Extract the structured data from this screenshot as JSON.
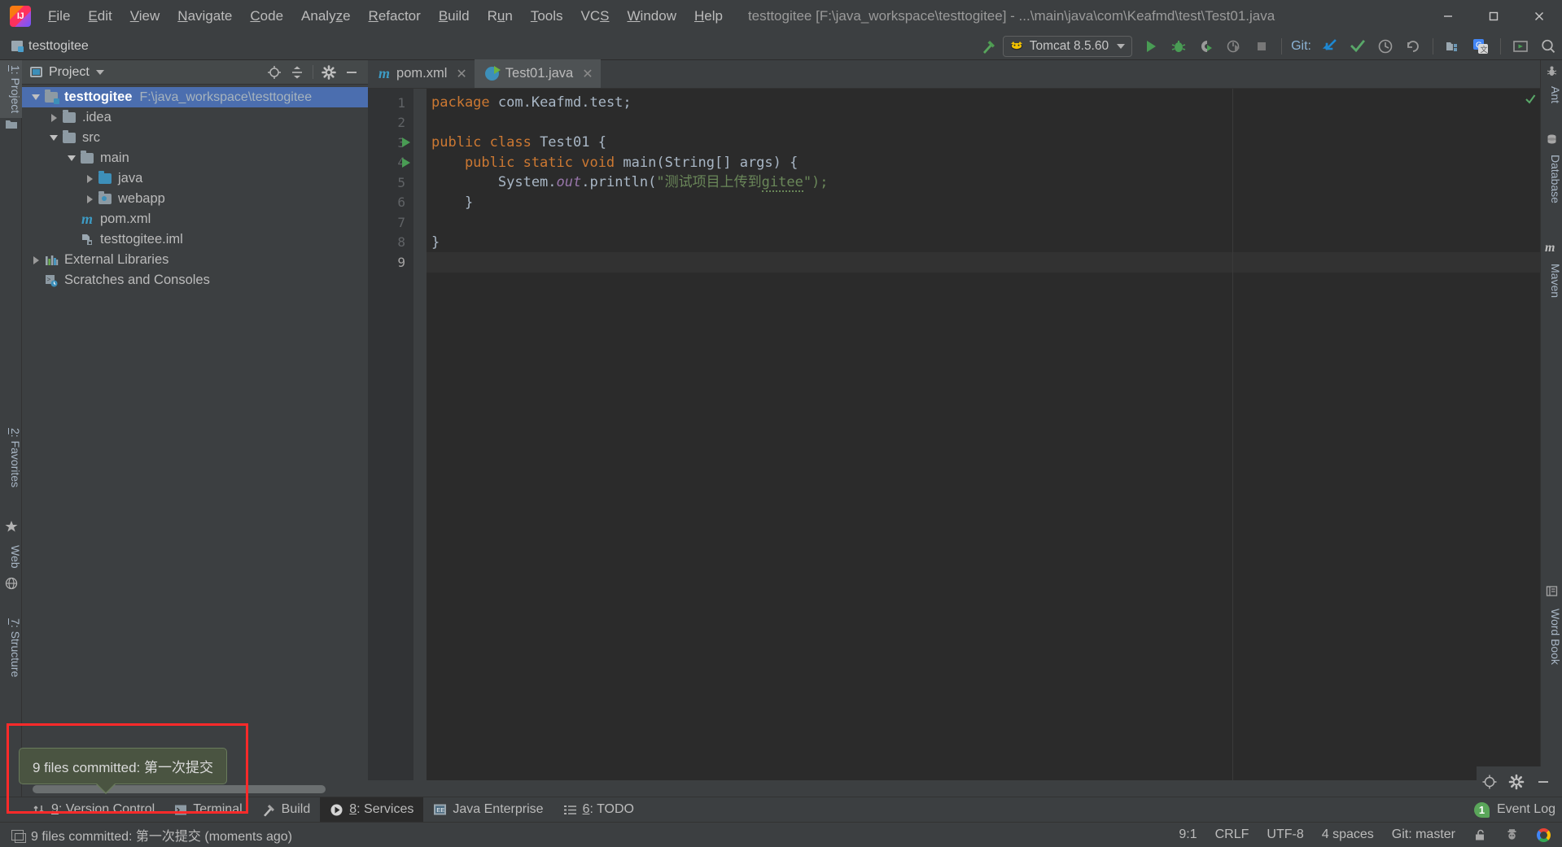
{
  "window": {
    "title": "testtogitee [F:\\java_workspace\\testtogitee] - ...\\main\\java\\com\\Keafmd\\test\\Test01.java",
    "minimize": "—",
    "maximize": "☐",
    "close": "✕"
  },
  "menu": {
    "items": [
      {
        "pre": "",
        "mn": "F",
        "post": "ile"
      },
      {
        "pre": "",
        "mn": "E",
        "post": "dit"
      },
      {
        "pre": "",
        "mn": "V",
        "post": "iew"
      },
      {
        "pre": "",
        "mn": "N",
        "post": "avigate"
      },
      {
        "pre": "",
        "mn": "C",
        "post": "ode"
      },
      {
        "pre": "Analy",
        "mn": "z",
        "post": "e"
      },
      {
        "pre": "",
        "mn": "R",
        "post": "efactor"
      },
      {
        "pre": "",
        "mn": "B",
        "post": "uild"
      },
      {
        "pre": "R",
        "mn": "u",
        "post": "n"
      },
      {
        "pre": "",
        "mn": "T",
        "post": "ools"
      },
      {
        "pre": "VC",
        "mn": "S",
        "post": ""
      },
      {
        "pre": "",
        "mn": "W",
        "post": "indow"
      },
      {
        "pre": "",
        "mn": "H",
        "post": "elp"
      }
    ]
  },
  "toolbar": {
    "project_chip": "testtogitee",
    "run_config": "Tomcat 8.5.60",
    "git_label": "Git:",
    "icons": {
      "build_hammer": "build-hammer-icon",
      "run": "run-icon",
      "debug": "debug-icon",
      "run_coverage": "run-with-coverage-icon",
      "profile": "profiler-icon",
      "stop": "stop-icon",
      "update_project": "git-update-project-icon",
      "commit": "git-commit-icon",
      "history": "git-history-icon",
      "rollback": "git-rollback-icon",
      "project_structure": "project-structure-icon",
      "translate": "translate-icon",
      "run_anything": "run-anything-icon",
      "search_everywhere": "search-everywhere-icon"
    }
  },
  "left_strip": {
    "tabs": [
      {
        "num": "1",
        "label": ": Project",
        "selected": true
      },
      {
        "num": "2",
        "label": ": Favorites",
        "selected": false
      },
      {
        "num": "",
        "label": "Web",
        "selected": false
      },
      {
        "num": "7",
        "label": ": Structure",
        "selected": false
      }
    ]
  },
  "right_strip": {
    "tabs": [
      {
        "label": "Ant"
      },
      {
        "label": "Database"
      },
      {
        "label": "Maven"
      },
      {
        "label": "Word Book"
      }
    ]
  },
  "project_panel": {
    "title": "Project",
    "actions": [
      "locate-icon",
      "collapse-all-icon",
      "settings-gear-icon",
      "hide-icon"
    ],
    "tree": [
      {
        "indent": 0,
        "toggle": "down",
        "icon": "module-folder",
        "label": "testtogitee",
        "bold": true,
        "path": "F:\\java_workspace\\testtogitee",
        "selected": true
      },
      {
        "indent": 1,
        "toggle": "right",
        "icon": "folder",
        "label": ".idea",
        "bold": false,
        "path": "",
        "selected": false
      },
      {
        "indent": 1,
        "toggle": "down",
        "icon": "folder",
        "label": "src",
        "bold": false,
        "path": "",
        "selected": false
      },
      {
        "indent": 2,
        "toggle": "down",
        "icon": "folder",
        "label": "main",
        "bold": false,
        "path": "",
        "selected": false
      },
      {
        "indent": 3,
        "toggle": "right",
        "icon": "source-folder",
        "label": "java",
        "bold": false,
        "path": "",
        "selected": false
      },
      {
        "indent": 3,
        "toggle": "right",
        "icon": "web-folder",
        "label": "webapp",
        "bold": false,
        "path": "",
        "selected": false
      },
      {
        "indent": 2,
        "toggle": "none",
        "icon": "maven-file",
        "label": "pom.xml",
        "bold": false,
        "path": "",
        "selected": false
      },
      {
        "indent": 2,
        "toggle": "none",
        "icon": "iml-file",
        "label": "testtogitee.iml",
        "bold": false,
        "path": "",
        "selected": false
      },
      {
        "indent": 0,
        "toggle": "right",
        "icon": "libraries",
        "label": "External Libraries",
        "bold": false,
        "path": "",
        "selected": false
      },
      {
        "indent": 0,
        "toggle": "none",
        "icon": "scratches",
        "label": "Scratches and Consoles",
        "bold": false,
        "path": "",
        "selected": false
      }
    ]
  },
  "editor": {
    "tabs": [
      {
        "label": "pom.xml",
        "icon": "maven-file-icon",
        "active": false,
        "close": "✕"
      },
      {
        "label": "Test01.java",
        "icon": "java-class-icon",
        "active": true,
        "close": "✕"
      }
    ],
    "lines": [
      {
        "n": "1",
        "runmark": false,
        "fold": "",
        "current": false
      },
      {
        "n": "2",
        "runmark": false,
        "fold": "",
        "current": false
      },
      {
        "n": "3",
        "runmark": true,
        "fold": "",
        "current": false
      },
      {
        "n": "4",
        "runmark": true,
        "fold": "open",
        "current": false
      },
      {
        "n": "5",
        "runmark": false,
        "fold": "",
        "current": false
      },
      {
        "n": "6",
        "runmark": false,
        "fold": "close",
        "current": false
      },
      {
        "n": "7",
        "runmark": false,
        "fold": "",
        "current": false
      },
      {
        "n": "8",
        "runmark": false,
        "fold": "",
        "current": false
      },
      {
        "n": "9",
        "runmark": false,
        "fold": "",
        "current": true
      }
    ],
    "code": {
      "l1_kw": "package",
      "l1_rest": " com.Keafmd.test;",
      "l3_a": "public class ",
      "l3_b": "Test01 {",
      "l4_a": "    public static void ",
      "l4_b": "main",
      "l4_c": "(String[] args) {",
      "l5_a": "        System.",
      "l5_b": "out",
      "l5_c": ".println(",
      "l5_str": "\"测试项目上传到",
      "l5_link": "gitee",
      "l5_end": "\");",
      "l6": "    }",
      "l8": "}"
    }
  },
  "notification": {
    "balloon_text": "9 files committed: 第一次提交"
  },
  "bottom_bar": {
    "tabs": [
      {
        "num": "9",
        "label": ": Version Control",
        "icon": "version-control-icon",
        "selected": false
      },
      {
        "num": "",
        "label": "Terminal",
        "icon": "terminal-icon",
        "selected": false
      },
      {
        "num": "",
        "label": "Build",
        "icon": "build-hammer-icon",
        "selected": false
      },
      {
        "num": "8",
        "label": ": Services",
        "icon": "services-icon",
        "selected": true
      },
      {
        "num": "",
        "label": "Java Enterprise",
        "icon": "java-enterprise-icon",
        "selected": false
      },
      {
        "num": "6",
        "label": ": TODO",
        "icon": "todo-icon",
        "selected": false
      }
    ],
    "event_log": {
      "badge": "1",
      "label": "Event Log"
    }
  },
  "status_bar": {
    "message": "9 files committed: 第一次提交 (moments ago)",
    "caret": "9:1",
    "line_sep": "CRLF",
    "encoding": "UTF-8",
    "indent": "4 spaces",
    "branch": "Git: master",
    "lock_icon": "unlocked-icon",
    "inspector_icon": "hector-inspection-icon",
    "google_icon": "google-icon"
  }
}
